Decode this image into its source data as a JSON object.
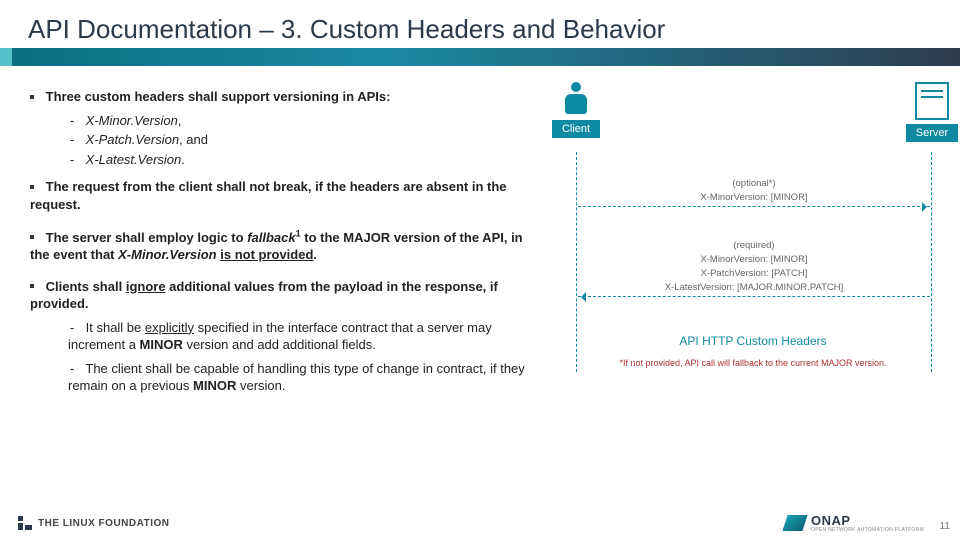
{
  "title": "API Documentation – 3. Custom Headers and Behavior",
  "bullets": {
    "b1": "Three custom headers shall support versioning in APIs:",
    "b1s1": "X-Minor.Version",
    "b1s1_tail": ",",
    "b1s2": "X-Patch.Version",
    "b1s2_tail": ", and",
    "b1s3": "X-Latest.Version",
    "b1s3_tail": ".",
    "b2": "The request from the client shall not break, if the headers are absent in the request.",
    "b3_pre": "The server shall employ logic to ",
    "b3_em": "fallback",
    "b3_sup": "1",
    "b3_mid": " to the ",
    "b3_strong": "MAJOR",
    "b3_post1": " version of the API, in the event that ",
    "b3_em2": "X-Minor.Version",
    "b3_post2": " ",
    "b3_under": "is not provided",
    "b3_tail": ".",
    "b4_pre": "Clients shall ",
    "b4_under": "ignore",
    "b4_post": " additional values from the payload in the response, if provided.",
    "b4s1_pre": "It shall be ",
    "b4s1_under": "explicitly",
    "b4s1_mid": " specified in the interface contract that a server may increment a ",
    "b4s1_strong": "MINOR",
    "b4s1_tail": " version and add additional fields.",
    "b4s2_pre": "The client shall be capable of handling this type of change in contract, if they remain on a previous ",
    "b4s2_strong": "MINOR",
    "b4s2_tail": " version."
  },
  "diagram": {
    "client_label": "Client",
    "server_label": "Server",
    "req_line1": "(optional*)",
    "req_line2": "X-MinorVersion: [MINOR]",
    "res_line1": "(required)",
    "res_line2": "X-MinorVersion: [MINOR]",
    "res_line3": "X-PatchVersion: [PATCH]",
    "res_line4": "X-LatestVersion: [MAJOR.MINOR.PATCH]",
    "caption": "API HTTP Custom Headers",
    "footnote": "*If not provided, API call will fallback to the current MAJOR version."
  },
  "footer": {
    "linux": "THE LINUX FOUNDATION",
    "onap": "ONAP",
    "onap_sub": "OPEN NETWORK AUTOMATION PLATFORM",
    "page": "11"
  }
}
